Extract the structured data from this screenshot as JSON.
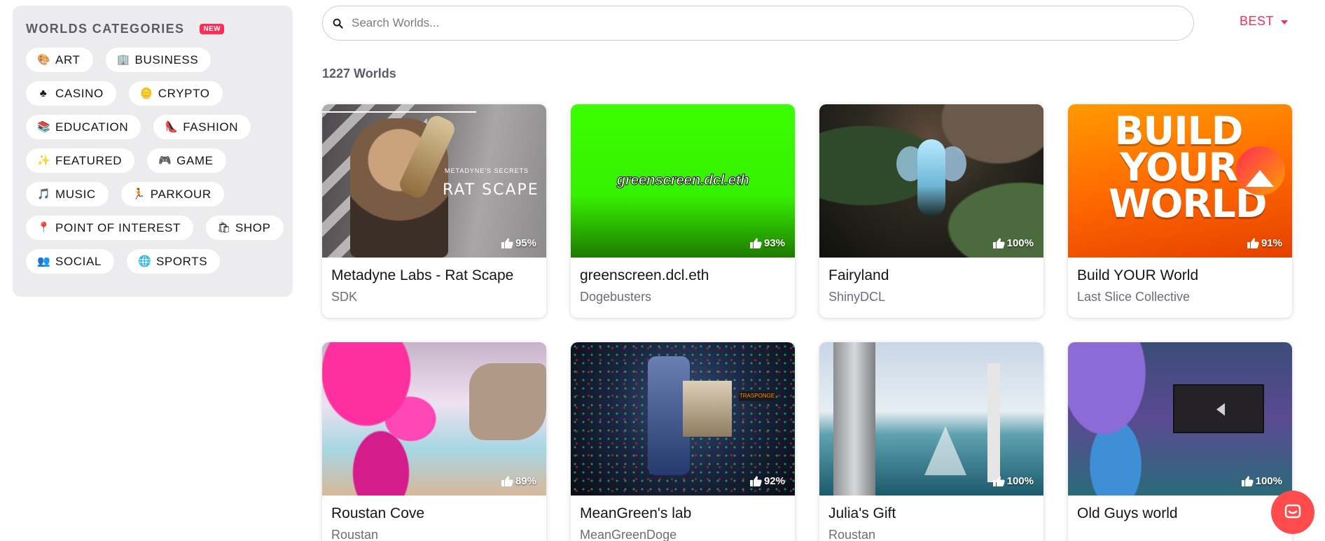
{
  "sidebar": {
    "title": "WORLDS CATEGORIES",
    "badge": "NEW",
    "rows": [
      [
        {
          "label": "ART",
          "icon": "palette-icon",
          "glyph": "🎨"
        },
        {
          "label": "BUSINESS",
          "icon": "office-building-icon",
          "glyph": "🏢"
        }
      ],
      [
        {
          "label": "CASINO",
          "icon": "club-suit-icon",
          "glyph": "♣"
        },
        {
          "label": "CRYPTO",
          "icon": "coin-icon",
          "glyph": "🪙"
        }
      ],
      [
        {
          "label": "EDUCATION",
          "icon": "books-icon",
          "glyph": "📚"
        },
        {
          "label": "FASHION",
          "icon": "high-heel-icon",
          "glyph": "👠"
        }
      ],
      [
        {
          "label": "FEATURED",
          "icon": "sparkles-icon",
          "glyph": "✨"
        },
        {
          "label": "GAME",
          "icon": "game-controller-icon",
          "glyph": "🎮"
        }
      ],
      [
        {
          "label": "MUSIC",
          "icon": "music-note-icon",
          "glyph": "🎵"
        },
        {
          "label": "PARKOUR",
          "icon": "runner-icon",
          "glyph": "🏃"
        }
      ],
      [
        {
          "label": "POINT OF INTEREST",
          "icon": "map-pin-icon",
          "glyph": "📍"
        },
        {
          "label": "SHOP",
          "icon": "shopping-bags-icon",
          "glyph": "🛍"
        }
      ],
      [
        {
          "label": "SOCIAL",
          "icon": "people-icon",
          "glyph": "👥"
        },
        {
          "label": "SPORTS",
          "icon": "globe-ball-icon",
          "glyph": "🌐"
        }
      ]
    ]
  },
  "search": {
    "placeholder": "Search Worlds...",
    "value": ""
  },
  "sort": {
    "label": "BEST"
  },
  "count": "1227 Worlds",
  "worlds": [
    {
      "title": "Metadyne Labs - Rat Scape",
      "author": "SDK",
      "rating": "95%",
      "thumb": "t-rat",
      "thumb_text": "RAT SCAPE",
      "thumb_subtext": "METADYNE'S SECRETS"
    },
    {
      "title": "greenscreen.dcl.eth",
      "author": "Dogebusters",
      "rating": "93%",
      "thumb": "t-green",
      "thumb_text": "greenscreen.dcl.eth"
    },
    {
      "title": "Fairyland",
      "author": "ShinyDCL",
      "rating": "100%",
      "thumb": "t-fairy"
    },
    {
      "title": "Build YOUR World",
      "author": "Last Slice Collective",
      "rating": "91%",
      "thumb": "t-build",
      "thumb_text": "BUILD YOUR WORLD"
    },
    {
      "title": "Roustan Cove",
      "author": "Roustan",
      "rating": "89%",
      "thumb": "t-roustan"
    },
    {
      "title": "MeanGreen's lab",
      "author": "MeanGreenDoge",
      "rating": "92%",
      "thumb": "t-lab",
      "thumb_text": "TRASPONGE"
    },
    {
      "title": "Julia's Gift",
      "author": "Roustan",
      "rating": "100%",
      "thumb": "t-julia"
    },
    {
      "title": "Old Guys world",
      "author": "",
      "rating": "100%",
      "thumb": "t-oldguys"
    }
  ],
  "colors": {
    "accent": "#ff2d55",
    "sidebar_bg": "#ecebed",
    "chat_fab": "#ff4b4b"
  }
}
